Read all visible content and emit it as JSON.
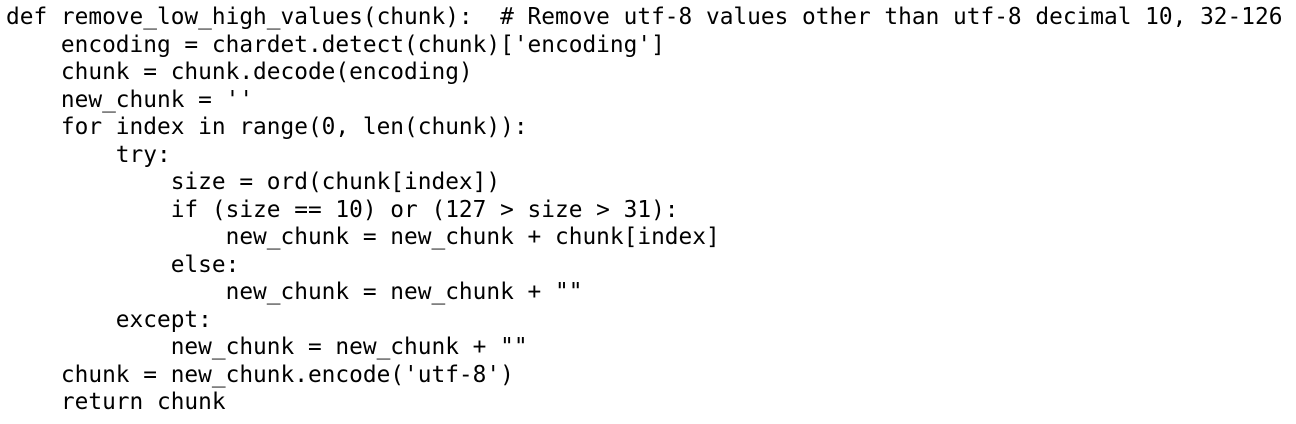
{
  "code": {
    "lines": [
      "def remove_low_high_values(chunk):  # Remove utf-8 values other than utf-8 decimal 10, 32-126",
      "    encoding = chardet.detect(chunk)['encoding']",
      "    chunk = chunk.decode(encoding)",
      "    new_chunk = ''",
      "    for index in range(0, len(chunk)):",
      "        try:",
      "            size = ord(chunk[index])",
      "            if (size == 10) or (127 > size > 31):",
      "                new_chunk = new_chunk + chunk[index]",
      "            else:",
      "                new_chunk = new_chunk + \"\"",
      "        except:",
      "            new_chunk = new_chunk + \"\"",
      "    chunk = new_chunk.encode('utf-8')",
      "    return chunk"
    ]
  }
}
